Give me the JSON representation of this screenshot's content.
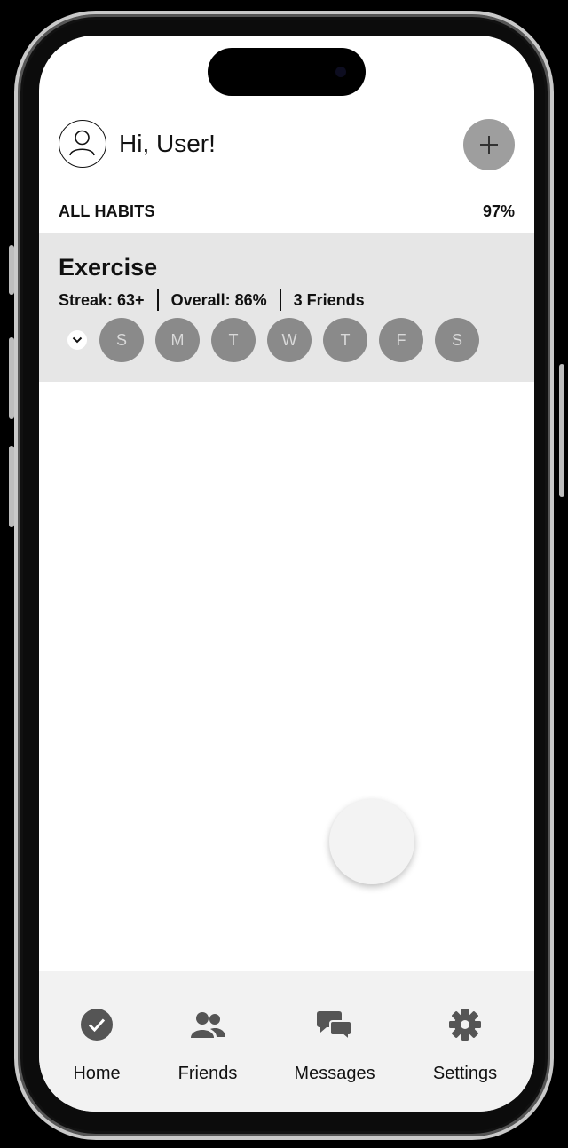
{
  "header": {
    "greeting": "Hi, User!",
    "avatar_icon": "user-avatar-icon",
    "add_icon": "plus-icon"
  },
  "summary": {
    "title": "ALL HABITS",
    "percent": "97%"
  },
  "habits": [
    {
      "name": "Exercise",
      "streak": "Streak: 63+",
      "overall": "Overall: 86%",
      "friends": "3 Friends",
      "days": [
        "S",
        "M",
        "T",
        "W",
        "T",
        "F",
        "S"
      ]
    }
  ],
  "nav": [
    {
      "label": "Home",
      "icon": "check-circle-icon"
    },
    {
      "label": "Friends",
      "icon": "people-icon"
    },
    {
      "label": "Messages",
      "icon": "chat-bubbles-icon"
    },
    {
      "label": "Settings",
      "icon": "gear-icon"
    }
  ],
  "colors": {
    "card_bg": "#e6e6e6",
    "day_bg": "#8a8a8a",
    "add_button": "#9e9e9e",
    "nav_bg": "#f2f2f2",
    "nav_icon": "#555555"
  }
}
